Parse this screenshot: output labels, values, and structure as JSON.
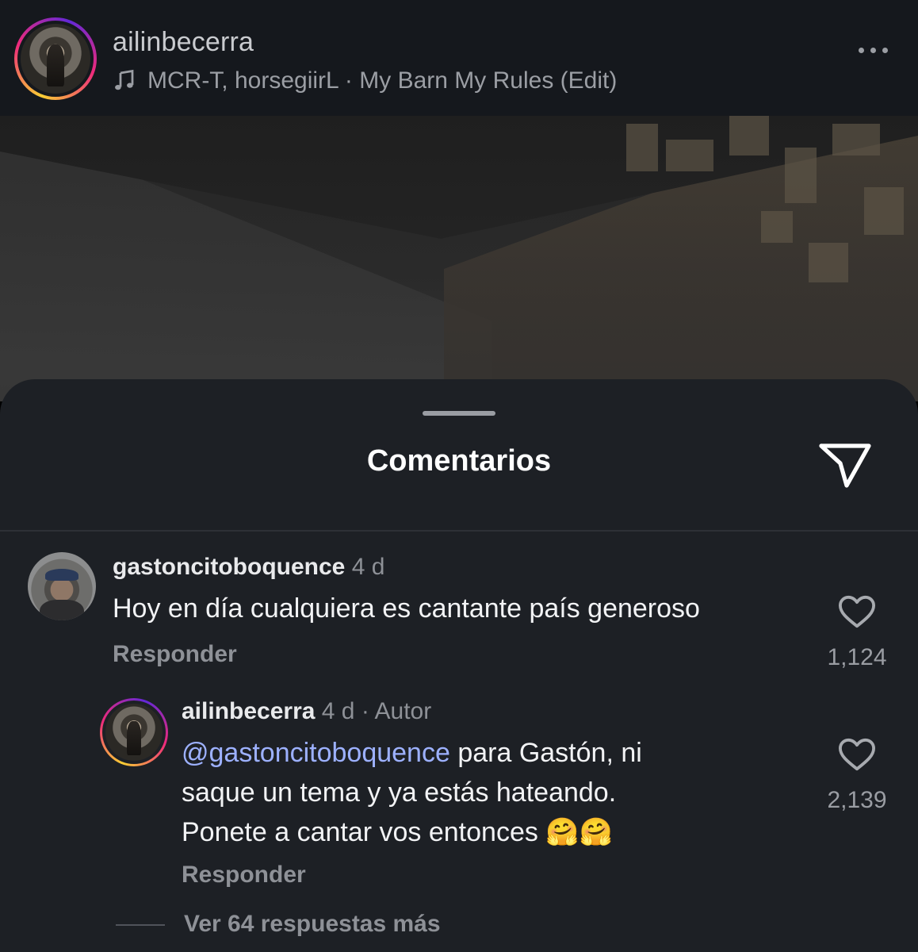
{
  "header": {
    "username": "ailinbecerra",
    "music": "MCR-T, horsegiirL · My Barn My Rules (Edit)",
    "more_icon": "more-horizontal-icon"
  },
  "comments_sheet": {
    "title": "Comentarios",
    "share_icon": "paper-plane-icon",
    "comments": [
      {
        "username": "gastoncitoboquence",
        "time": "4 d",
        "text": "Hoy en día cualquiera es cantante país generoso",
        "reply_label": "Responder",
        "likes": "1,124",
        "like_icon": "heart-icon"
      }
    ],
    "reply": {
      "username": "ailinbecerra",
      "time": "4 d",
      "author_badge": "· Autor",
      "mention": "@gastoncitoboquence",
      "text_line1": " para Gastón, ni",
      "text_line2": "saque un tema y ya estás hateando.",
      "text_line3": "Ponete a cantar vos entonces 🤗🤗",
      "reply_label": "Responder",
      "likes": "2,139",
      "like_icon": "heart-icon"
    },
    "view_more": "Ver 64 respuestas más"
  },
  "colors": {
    "sheet_bg": "#1d2025",
    "header_bg": "#15181d",
    "mention": "#9db1ff",
    "muted_text": "#8e9197"
  }
}
